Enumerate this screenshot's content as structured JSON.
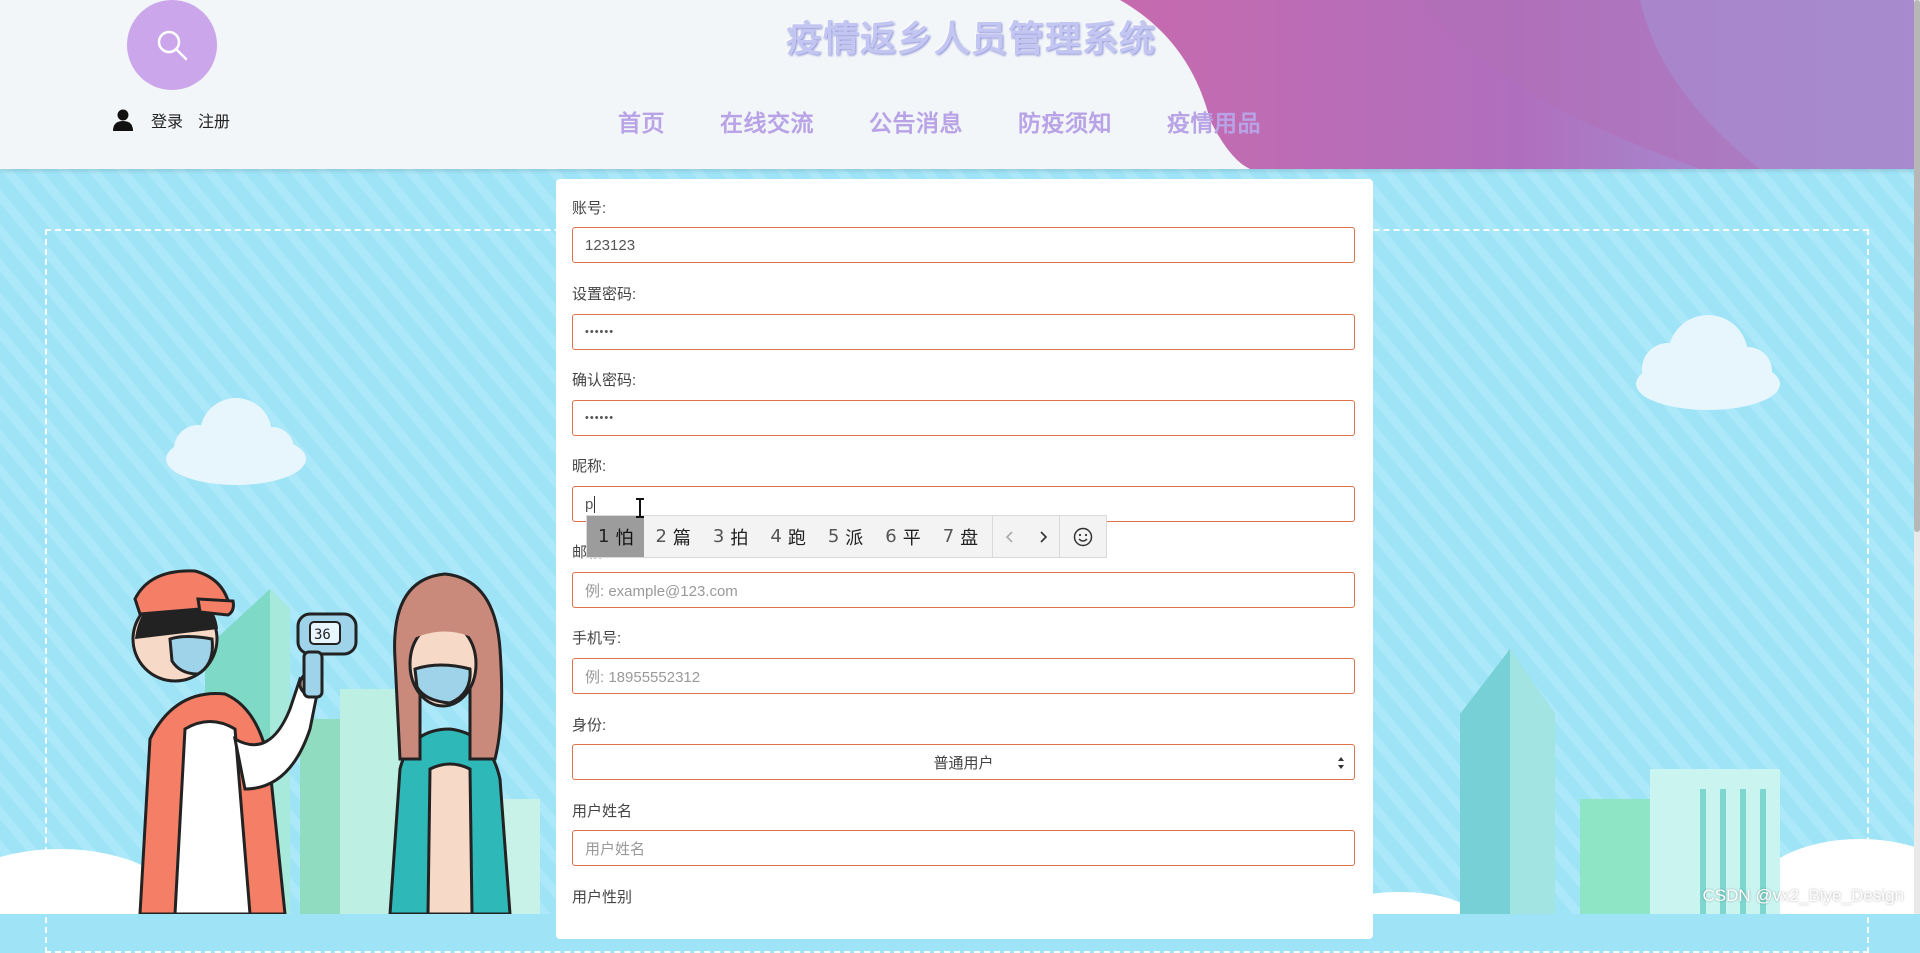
{
  "header": {
    "title": "疫情返乡人员管理系统",
    "search_icon": "search-icon",
    "user_icon": "user-icon",
    "login_label": "登录",
    "register_label": "注册",
    "nav": [
      "首页",
      "在线交流",
      "公告消息",
      "防疫须知",
      "疫情用品"
    ]
  },
  "form": {
    "account_label": "账号:",
    "account_value": "123123",
    "password_label": "设置密码:",
    "password_value": "••••••",
    "confirm_label": "确认密码:",
    "confirm_value": "••••••",
    "nickname_label": "昵称:",
    "nickname_value": "p",
    "email_label": "邮箱:",
    "email_placeholder": "例: example@123.com",
    "phone_label": "手机号:",
    "phone_placeholder": "例: 18955552312",
    "role_label": "身份:",
    "role_selected": "普通用户",
    "realname_label": "用户姓名",
    "realname_placeholder": "用户姓名",
    "gender_label": "用户性别"
  },
  "ime": {
    "candidates": [
      {
        "num": "1",
        "char": "怕"
      },
      {
        "num": "2",
        "char": "篇"
      },
      {
        "num": "3",
        "char": "拍"
      },
      {
        "num": "4",
        "char": "跑"
      },
      {
        "num": "5",
        "char": "派"
      },
      {
        "num": "6",
        "char": "平"
      },
      {
        "num": "7",
        "char": "盘"
      }
    ],
    "prev_icon": "chevron-left-icon",
    "next_icon": "chevron-right-icon",
    "emoji_icon": "smiley-icon"
  },
  "watermark": "CSDN @vx2_Biye_Design",
  "colors": {
    "header_bg": "#f3f6f8",
    "accent_purple": "#cba6ea",
    "nav_text": "#b8a3e6",
    "input_border": "#e0714a",
    "sky": "#9fe3f7"
  }
}
